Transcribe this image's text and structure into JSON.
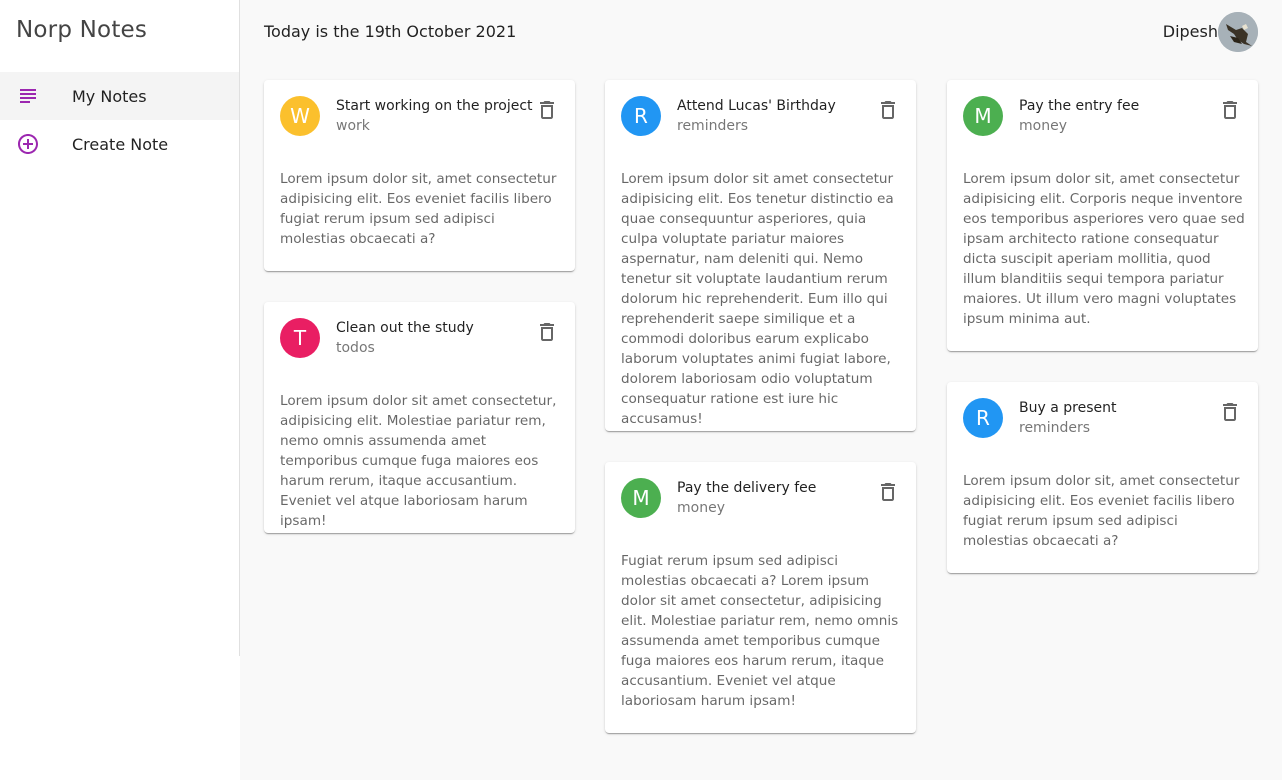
{
  "app": {
    "title": "Norp Notes"
  },
  "nav": {
    "items": [
      {
        "label": "My Notes",
        "icon": "notes-list-icon"
      },
      {
        "label": "Create Note",
        "icon": "add-circle-icon"
      }
    ]
  },
  "header": {
    "date": "Today is the 19th October 2021",
    "user": "Dipesh"
  },
  "colors": {
    "accent": "#9c27b0",
    "work": "#fbc02d",
    "reminders": "#2196f3",
    "money": "#4caf50",
    "todos": "#e91e63"
  },
  "notes": [
    {
      "initial": "W",
      "title": "Start working on the project",
      "category": "work",
      "body": "Lorem ipsum dolor sit, amet consectetur adipisicing elit. Eos eveniet facilis libero fugiat rerum ipsum sed adipisci molestias obcaecati a?"
    },
    {
      "initial": "T",
      "title": "Clean out the study",
      "category": "todos",
      "body": "Lorem ipsum dolor sit amet consectetur, adipisicing elit. Molestiae pariatur rem, nemo omnis assumenda amet temporibus cumque fuga maiores eos harum rerum, itaque accusantium. Eveniet vel atque laboriosam harum ipsam!"
    },
    {
      "initial": "R",
      "title": "Attend Lucas' Birthday",
      "category": "reminders",
      "body": "Lorem ipsum dolor sit amet consectetur adipisicing elit. Eos tenetur distinctio ea quae consequuntur asperiores, quia culpa voluptate pariatur maiores aspernatur, nam deleniti qui. Nemo tenetur sit voluptate laudantium rerum dolorum hic reprehenderit. Eum illo qui reprehenderit saepe similique et a commodi doloribus earum explicabo laborum voluptates animi fugiat labore, dolorem laboriosam odio voluptatum consequatur ratione est iure hic accusamus!"
    },
    {
      "initial": "M",
      "title": "Pay the delivery fee",
      "category": "money",
      "body": "Fugiat rerum ipsum sed adipisci molestias obcaecati a? Lorem ipsum dolor sit amet consectetur, adipisicing elit. Molestiae pariatur rem, nemo omnis assumenda amet temporibus cumque fuga maiores eos harum rerum, itaque accusantium. Eveniet vel atque laboriosam harum ipsam!"
    },
    {
      "initial": "M",
      "title": "Pay the entry fee",
      "category": "money",
      "body": "Lorem ipsum dolor sit, amet consectetur adipisicing elit. Corporis neque inventore eos temporibus asperiores vero quae sed ipsam architecto ratione consequatur dicta suscipit aperiam mollitia, quod illum blanditiis sequi tempora pariatur maiores. Ut illum vero magni voluptates ipsum minima aut."
    },
    {
      "initial": "R",
      "title": "Buy a present",
      "category": "reminders",
      "body": "Lorem ipsum dolor sit, amet consectetur adipisicing elit. Eos eveniet facilis libero fugiat rerum ipsum sed adipisci molestias obcaecati a?"
    }
  ]
}
